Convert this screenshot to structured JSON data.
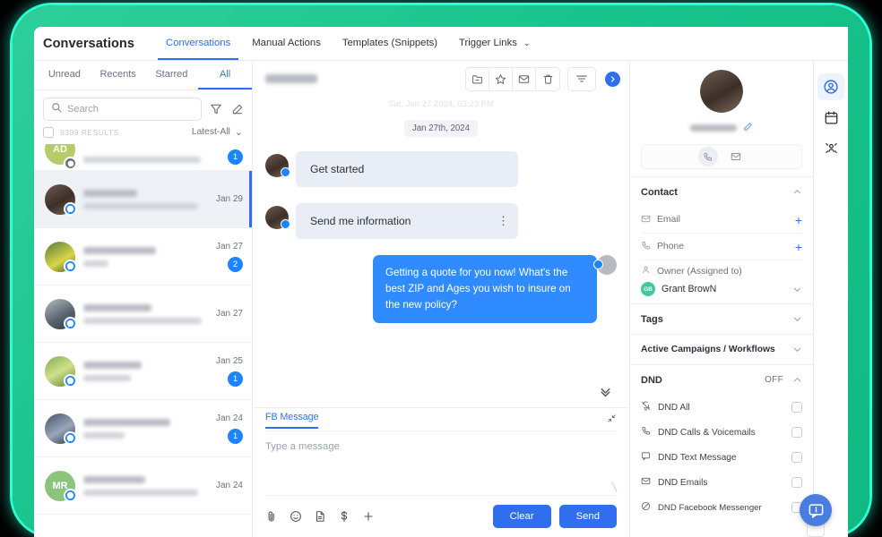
{
  "app": {
    "title": "Conversations"
  },
  "nav_tabs": [
    {
      "label": "Conversations",
      "active": true
    },
    {
      "label": "Manual Actions",
      "active": false
    },
    {
      "label": "Templates (Snippets)",
      "active": false
    },
    {
      "label": "Trigger Links",
      "active": false,
      "caret": "⌄"
    }
  ],
  "list_panel": {
    "filter_tabs": [
      {
        "label": "Unread"
      },
      {
        "label": "Recents"
      },
      {
        "label": "Starred"
      },
      {
        "label": "All"
      }
    ],
    "search": {
      "placeholder": "Search",
      "value": ""
    },
    "results_count": "9399 RESULTS",
    "sort_label": "Latest-All",
    "sort_caret": "⌄",
    "items": [
      {
        "name": "",
        "preview": "",
        "date": "",
        "unread": "1",
        "avatar_initials": "AD",
        "avatar_style": "img-g",
        "badge": "messenger",
        "active": false,
        "partial": true
      },
      {
        "name": "",
        "preview": "",
        "date": "Jan 29",
        "unread": "",
        "avatar_initials": "",
        "avatar_style": "img-a",
        "badge": "messenger",
        "active": true,
        "partial": false
      },
      {
        "name": "",
        "preview": "",
        "date": "Jan 27",
        "unread": "2",
        "avatar_initials": "",
        "avatar_style": "img-b",
        "badge": "messenger",
        "active": false,
        "partial": false
      },
      {
        "name": "",
        "preview": "",
        "date": "Jan 27",
        "unread": "",
        "avatar_initials": "",
        "avatar_style": "img-c",
        "badge": "messenger",
        "active": false,
        "partial": false
      },
      {
        "name": "",
        "preview": "",
        "date": "Jan 25",
        "unread": "1",
        "avatar_initials": "",
        "avatar_style": "img-d",
        "badge": "messenger",
        "active": false,
        "partial": false
      },
      {
        "name": "",
        "preview": "",
        "date": "Jan 24",
        "unread": "1",
        "avatar_initials": "",
        "avatar_style": "img-e",
        "badge": "messenger",
        "active": false,
        "partial": false
      },
      {
        "name": "",
        "preview": "",
        "date": "Jan 24",
        "unread": "",
        "avatar_initials": "MR",
        "avatar_style": "img-f",
        "badge": "messenger",
        "active": false,
        "partial": false
      }
    ]
  },
  "conversation": {
    "contact_name": "",
    "toolbar_icons": [
      "archive-icon",
      "star-icon",
      "envelope-icon",
      "trash-icon"
    ],
    "filter_icon": "filter-icon",
    "expand_icon": "chevron-right-icon",
    "faded_timestamp": "Sat, Jan 27 2024, 03:23 PM",
    "date_chip": "Jan 27th, 2024",
    "messages": [
      {
        "direction": "in",
        "text": "Get started",
        "has_menu": false
      },
      {
        "direction": "in",
        "text": "Send me information",
        "has_menu": true
      },
      {
        "direction": "out",
        "text": "Getting a quote for you now! What's the best ZIP and Ages you wish to insure on the new policy?",
        "has_menu": false
      }
    ]
  },
  "composer": {
    "tab_label": "FB Message",
    "placeholder": "Type a message",
    "value": "",
    "icons": [
      "attachment-icon",
      "emoji-icon",
      "document-icon",
      "dollar-icon",
      "plus-icon"
    ],
    "clear_label": "Clear",
    "send_label": "Send"
  },
  "contact_panel": {
    "name": "",
    "edit_icon": "pencil-icon",
    "quick_actions": [
      "phone-icon",
      "envelope-icon"
    ],
    "sections": {
      "contact": {
        "title": "Contact",
        "fields": [
          {
            "label": "Email",
            "icon": "envelope-icon",
            "add": "+"
          },
          {
            "label": "Phone",
            "icon": "phone-icon",
            "add": "+"
          }
        ],
        "owner_label": "Owner (Assigned to)",
        "owner_name": "Grant BrowN",
        "owner_initials": "GB"
      },
      "tags": {
        "title": "Tags"
      },
      "campaigns": {
        "title": "Active Campaigns / Workflows"
      },
      "dnd": {
        "title": "DND",
        "value": "OFF",
        "items": [
          {
            "label": "DND All",
            "icon": "bell-off-icon",
            "checked": false
          },
          {
            "label": "DND Calls & Voicemails",
            "icon": "phone-icon",
            "checked": false
          },
          {
            "label": "DND Text Message",
            "icon": "chat-icon",
            "checked": false
          },
          {
            "label": "DND Emails",
            "icon": "envelope-icon",
            "checked": false
          },
          {
            "label": "DND Facebook Messenger",
            "icon": "no-entry-icon",
            "checked": false
          }
        ]
      }
    }
  },
  "icon_rail": [
    {
      "name": "contact-icon",
      "active": true
    },
    {
      "name": "calendar-icon",
      "active": false
    },
    {
      "name": "opportunities-icon",
      "active": false
    }
  ],
  "chat_widget": {
    "icon": "help-chat-icon"
  },
  "colors": {
    "accent_blue": "#2f6fed",
    "bubble_out": "#2f8bff",
    "bubble_in": "#e9edf5",
    "frame_green": "#10b981",
    "frame_glow": "#29ffd2",
    "owner_green": "#3ec9a0",
    "unread_blue": "#1b84ff"
  }
}
